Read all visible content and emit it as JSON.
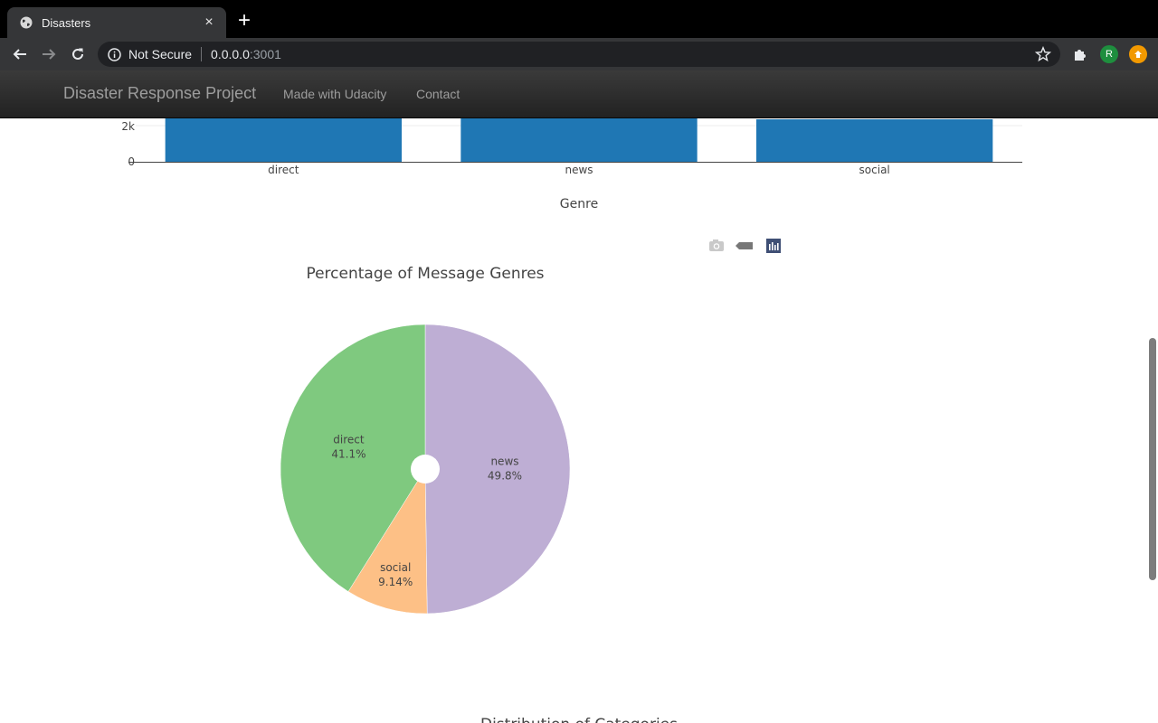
{
  "browser": {
    "tab_title": "Disasters",
    "tab_close": "×",
    "new_tab": "+",
    "security_label": "Not Secure",
    "url_host": "0.0.0.0",
    "url_port": ":3001",
    "profile_initial": "R"
  },
  "navbar": {
    "brand": "Disaster Response Project",
    "links": [
      "Made with Udacity",
      "Contact"
    ]
  },
  "colors": {
    "bar": "#1f77b4",
    "pie_direct": "#7fc97f",
    "pie_news": "#beaed4",
    "pie_social": "#fdc086"
  },
  "chart_data": [
    {
      "type": "bar",
      "title": "",
      "xlabel": "Genre",
      "categories": [
        "direct",
        "news",
        "social"
      ],
      "y_tick_labels": [
        "0",
        "2k"
      ],
      "note": "partially scrolled out of view; only bottom portion visible"
    },
    {
      "type": "pie",
      "title": "Percentage of Message Genres",
      "hole": true,
      "slices": [
        {
          "label": "news",
          "value": 49.8,
          "text": "49.8%"
        },
        {
          "label": "social",
          "value": 9.14,
          "text": "9.14%"
        },
        {
          "label": "direct",
          "value": 41.1,
          "text": "41.1%"
        }
      ]
    }
  ],
  "next_chart_title": "Distribution of Categories"
}
